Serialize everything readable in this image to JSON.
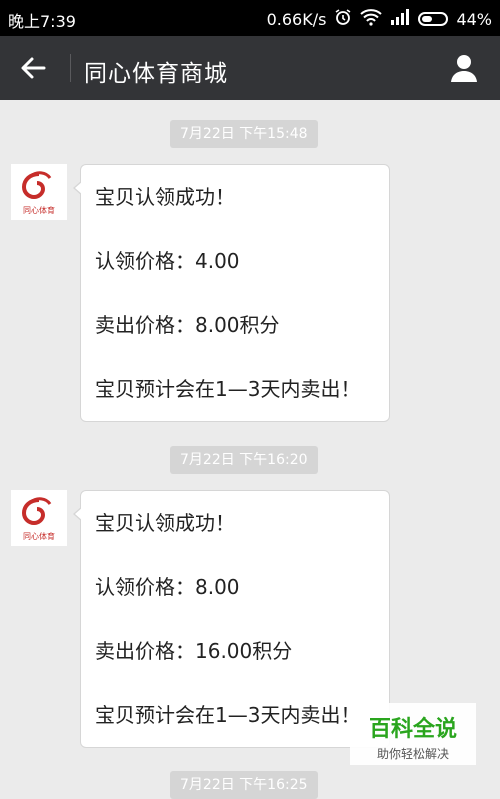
{
  "status_bar": {
    "time": "晚上7:39",
    "speed": "0.66K/s",
    "battery": "44%"
  },
  "nav": {
    "title": "同心体育商城"
  },
  "messages": [
    {
      "timestamp": "7月22日 下午15:48",
      "lines": [
        "宝贝认领成功！",
        "认领价格：4.00",
        "卖出价格：8.00积分",
        "宝贝预计会在1—3天内卖出！"
      ]
    },
    {
      "timestamp": "7月22日 下午16:20",
      "lines": [
        "宝贝认领成功！",
        "认领价格：8.00",
        "卖出价格：16.00积分",
        "宝贝预计会在1—3天内卖出！"
      ]
    },
    {
      "timestamp": "7月22日 下午16:25"
    }
  ],
  "avatar_text": "同心体育",
  "watermark": {
    "title": "百科全说",
    "subtitle": "助你轻松解决"
  },
  "colors": {
    "navbar": "#333437",
    "brand_red": "#c62d2a",
    "watermark_green": "#2aa51e"
  }
}
